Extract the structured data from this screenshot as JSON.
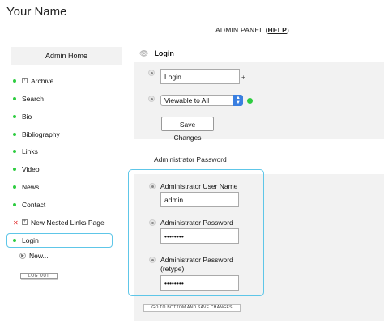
{
  "site": {
    "title": "Your Name"
  },
  "header": {
    "admin_panel": "ADMIN PANEL (",
    "help": "HELP",
    "close_paren": ")"
  },
  "sidebar": {
    "title": "Admin Home",
    "items": [
      {
        "label": "Archive",
        "marker": "bullet",
        "expandable": true
      },
      {
        "label": "Search",
        "marker": "bullet"
      },
      {
        "label": "Bio",
        "marker": "bullet"
      },
      {
        "label": "Bibliography",
        "marker": "bullet"
      },
      {
        "label": "Links",
        "marker": "bullet"
      },
      {
        "label": "Video",
        "marker": "bullet"
      },
      {
        "label": "News",
        "marker": "bullet"
      },
      {
        "label": "Contact",
        "marker": "bullet"
      },
      {
        "label": "New Nested Links Page",
        "marker": "x",
        "expandable": true
      },
      {
        "label": "Login",
        "marker": "bullet",
        "active": true
      }
    ],
    "new_label": "New...",
    "logout_label": "LOG OUT",
    "bullet_color": "#2ecc40",
    "x_color": "#e02020"
  },
  "login_section": {
    "heading": "Login",
    "title_value": "Login",
    "plus": "+",
    "visibility": "Viewable to All",
    "status_color": "#2ecc40",
    "save_label": "Save Changes"
  },
  "password_section": {
    "heading": "Administrator Password",
    "username_label": "Administrator User Name",
    "username_value": "admin",
    "password_label": "Administrator Password",
    "password_value": "••••••••",
    "retype_label_line1": "Administrator Password",
    "retype_label_line2": "(retype)",
    "retype_value": "••••••••"
  },
  "bottom_button": "GO TO BOTTOM AND SAVE CHANGES",
  "accent_color": "#5ec6e8"
}
